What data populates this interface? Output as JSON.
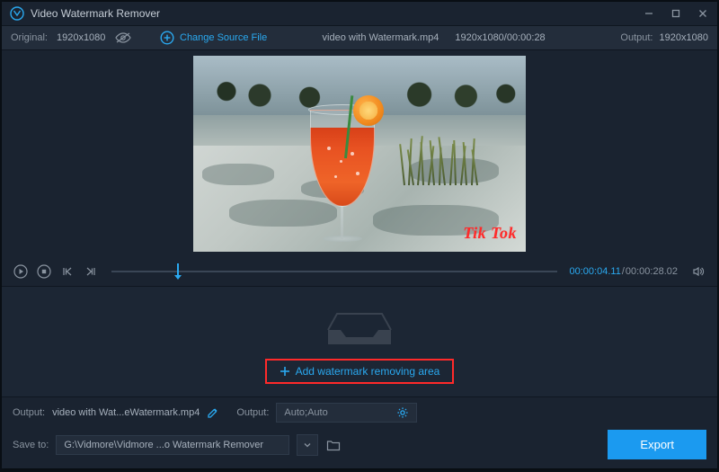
{
  "titlebar": {
    "app_name": "Video Watermark Remover"
  },
  "infobar": {
    "original_label": "Original:",
    "original_value": "1920x1080",
    "change_label": "Change Source File",
    "file_name": "video with Watermark.mp4",
    "file_meta": "1920x1080/00:00:28",
    "output_label": "Output:",
    "output_value": "1920x1080"
  },
  "preview": {
    "watermark_text": "Tik Tok"
  },
  "timeline": {
    "current": "00:00:04.11",
    "total": "00:00:28.02",
    "position_pct": 14.7
  },
  "add_area_label": "Add watermark removing area",
  "footer": {
    "output_label": "Output:",
    "output_filename": "video with Wat...eWatermark.mp4",
    "output2_label": "Output:",
    "output2_value": "Auto;Auto",
    "saveto_label": "Save to:",
    "saveto_path": "G:\\Vidmore\\Vidmore ...o Watermark Remover",
    "export_label": "Export"
  }
}
